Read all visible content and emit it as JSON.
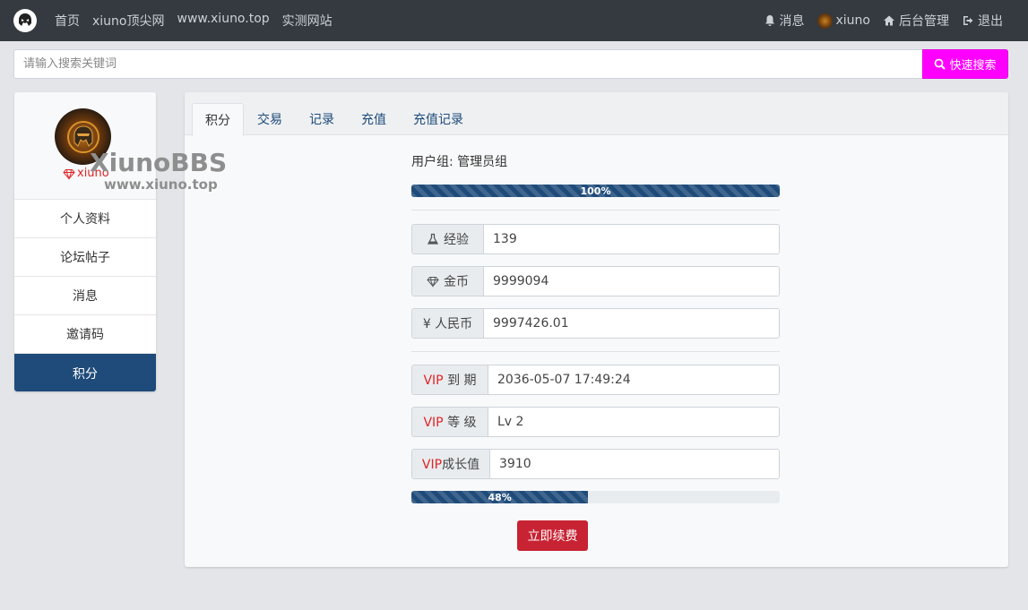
{
  "nav": {
    "links": [
      "首页",
      "xiuno顶尖网",
      "www.xiuno.top",
      "实测网站"
    ],
    "messages": "消息",
    "user": "xiuno",
    "admin": "后台管理",
    "logout": "退出"
  },
  "search": {
    "placeholder": "请输入搜索关键词",
    "button": "快速搜索",
    "accent": "#ff00ff"
  },
  "sidebar": {
    "username": "xiuno",
    "watermark_title": "XiunoBBS",
    "watermark_url": "www.xiuno.top",
    "items": [
      "个人资料",
      "论坛帖子",
      "消息",
      "邀请码",
      "积分"
    ],
    "active_index": 4,
    "active_color": "#1f4b7a"
  },
  "tabs": [
    "积分",
    "交易",
    "记录",
    "充值",
    "充值记录"
  ],
  "credits": {
    "usergroup": "用户组: 管理员组",
    "group_progress": 100,
    "group_progress_label": "100%",
    "exp_label": "经验",
    "exp_value": "139",
    "gold_label": "金币",
    "gold_value": "9999094",
    "rmb_label": "¥ 人民币",
    "rmb_value": "9997426.01",
    "vip_expire_prefix": "VIP",
    "vip_expire_label": " 到 期",
    "vip_expire_value": "2036-05-07 17:49:24",
    "vip_level_prefix": "VIP",
    "vip_level_label": " 等 级",
    "vip_level_value": "Lv 2",
    "vip_growth_prefix": "VIP",
    "vip_growth_label": "成长值",
    "vip_growth_value": "3910",
    "vip_progress": 48,
    "vip_progress_label": "48%",
    "renew_button": "立即续费",
    "renew_color": "#c82333"
  }
}
